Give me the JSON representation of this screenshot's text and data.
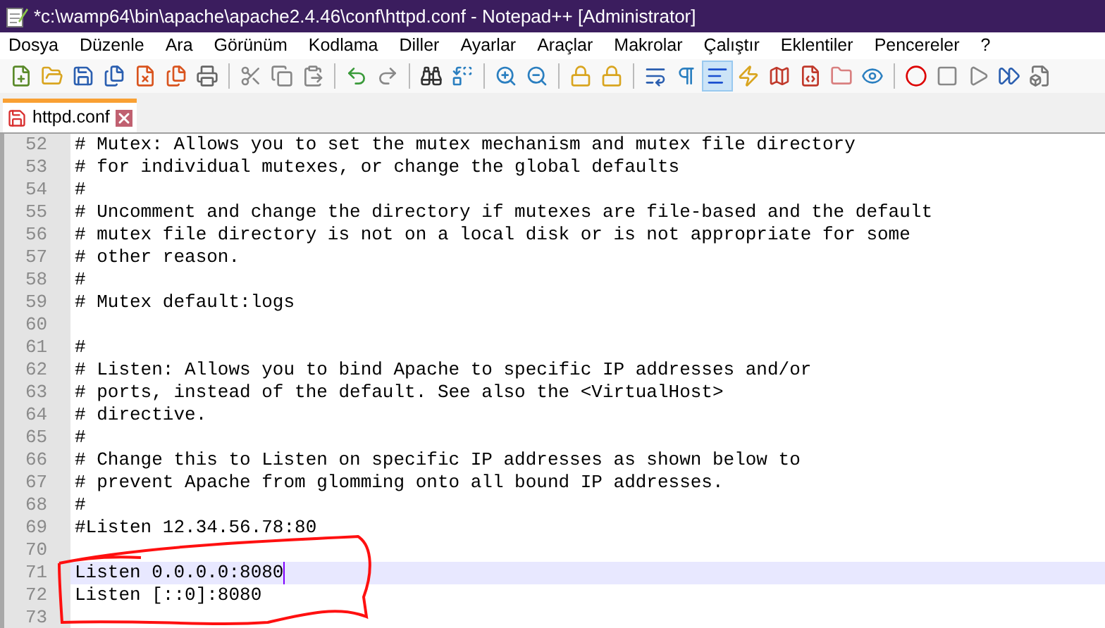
{
  "window": {
    "title": "*c:\\wamp64\\bin\\apache\\apache2.4.46\\conf\\httpd.conf - Notepad++ [Administrator]"
  },
  "menu": [
    "Dosya",
    "Düzenle",
    "Ara",
    "Görünüm",
    "Kodlama",
    "Diller",
    "Ayarlar",
    "Araçlar",
    "Makrolar",
    "Çalıştır",
    "Eklentiler",
    "Pencereler",
    "?"
  ],
  "toolbar": [
    [
      {
        "kind": "new",
        "selected": false
      },
      {
        "kind": "open",
        "selected": false
      },
      {
        "kind": "save",
        "selected": false
      },
      {
        "kind": "saveall",
        "selected": false
      },
      {
        "kind": "close",
        "selected": false
      },
      {
        "kind": "closeall",
        "selected": false
      },
      {
        "kind": "print",
        "selected": false
      }
    ],
    [
      {
        "kind": "cut",
        "selected": false
      },
      {
        "kind": "copy",
        "selected": false
      },
      {
        "kind": "paste",
        "selected": false
      }
    ],
    [
      {
        "kind": "undo",
        "selected": false
      },
      {
        "kind": "redo",
        "selected": false
      }
    ],
    [
      {
        "kind": "find",
        "selected": false
      },
      {
        "kind": "replace",
        "selected": false
      }
    ],
    [
      {
        "kind": "zoomin",
        "selected": false
      },
      {
        "kind": "zoomout",
        "selected": false
      }
    ],
    [
      {
        "kind": "syncv",
        "selected": false
      },
      {
        "kind": "synch",
        "selected": false
      }
    ],
    [
      {
        "kind": "wrap",
        "selected": false
      },
      {
        "kind": "allchars",
        "selected": false
      },
      {
        "kind": "indent",
        "selected": true
      },
      {
        "kind": "udl",
        "selected": false
      },
      {
        "kind": "map",
        "selected": false
      },
      {
        "kind": "function",
        "selected": false
      },
      {
        "kind": "folder",
        "selected": false
      },
      {
        "kind": "monitor",
        "selected": false
      }
    ],
    [
      {
        "kind": "record",
        "selected": false
      },
      {
        "kind": "stop",
        "selected": false
      },
      {
        "kind": "play",
        "selected": false
      },
      {
        "kind": "playmulti",
        "selected": false
      },
      {
        "kind": "savemacro",
        "selected": false
      }
    ]
  ],
  "tabs": [
    {
      "label": "httpd.conf",
      "selected": true,
      "modified": true
    }
  ],
  "editor": {
    "lines": [
      {
        "number": "52",
        "text": "# Mutex: Allows you to set the mutex mechanism and mutex file directory",
        "current": false
      },
      {
        "number": "53",
        "text": "# for individual mutexes, or change the global defaults",
        "current": false
      },
      {
        "number": "54",
        "text": "#",
        "current": false
      },
      {
        "number": "55",
        "text": "# Uncomment and change the directory if mutexes are file-based and the default",
        "current": false
      },
      {
        "number": "56",
        "text": "# mutex file directory is not on a local disk or is not appropriate for some",
        "current": false
      },
      {
        "number": "57",
        "text": "# other reason.",
        "current": false
      },
      {
        "number": "58",
        "text": "#",
        "current": false
      },
      {
        "number": "59",
        "text": "# Mutex default:logs",
        "current": false
      },
      {
        "number": "60",
        "current": false
      },
      {
        "number": "61",
        "text": "#",
        "current": false
      },
      {
        "number": "62",
        "text": "# Listen: Allows you to bind Apache to specific IP addresses and/or",
        "current": false
      },
      {
        "number": "63",
        "text": "# ports, instead of the default. See also the <VirtualHost>",
        "current": false
      },
      {
        "number": "64",
        "text": "# directive.",
        "current": false
      },
      {
        "number": "65",
        "text": "#",
        "current": false
      },
      {
        "number": "66",
        "text": "# Change this to Listen on specific IP addresses as shown below to",
        "current": false
      },
      {
        "number": "67",
        "text": "# prevent Apache from glomming onto all bound IP addresses.",
        "current": false
      },
      {
        "number": "68",
        "text": "#",
        "current": false
      },
      {
        "number": "69",
        "text": "#Listen 12.34.56.78:80",
        "current": false
      },
      {
        "number": "70",
        "current": false
      },
      {
        "number": "71",
        "text": "Listen 0.0.0.0:8080",
        "current": true
      },
      {
        "number": "72",
        "text": "Listen [::0]:8080",
        "current": false
      },
      {
        "number": "73",
        "current": false
      }
    ]
  }
}
